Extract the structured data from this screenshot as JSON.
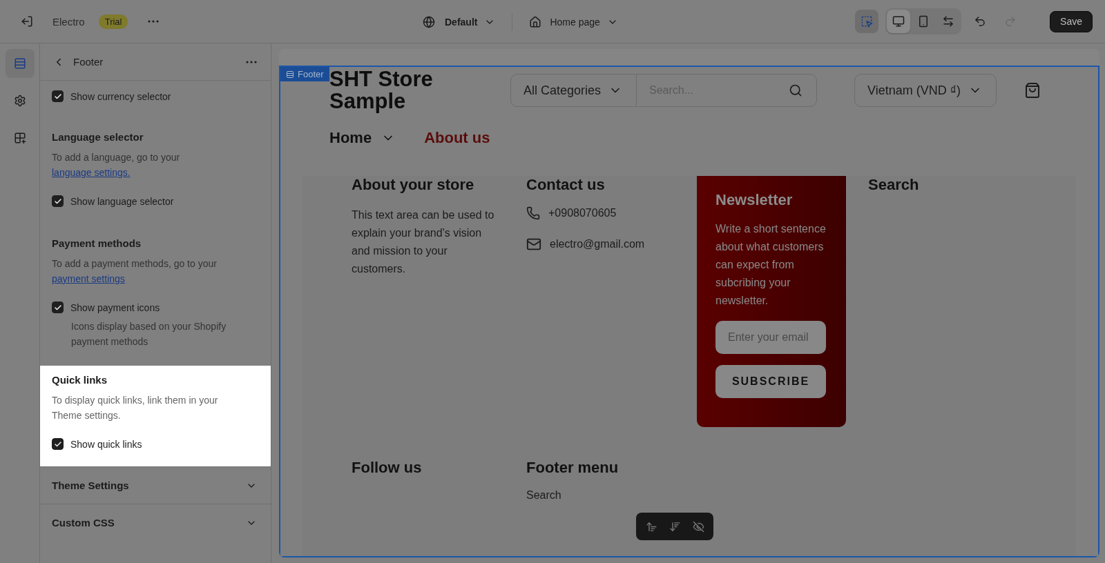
{
  "top_bar": {
    "store_name": "Electro",
    "plan_badge": "Trial",
    "theme": "Default",
    "page": "Home page",
    "inspect_selected": true,
    "devices": [
      {
        "kind": "desktop",
        "selected": true
      },
      {
        "kind": "mobile",
        "selected": false
      },
      {
        "kind": "fullwidth",
        "selected": false
      }
    ],
    "redo_disabled": true,
    "save": "Save"
  },
  "rail": [
    {
      "kind": "sections",
      "selected": true
    },
    {
      "kind": "settings",
      "selected": false
    },
    {
      "kind": "apps",
      "selected": false
    }
  ],
  "settings_panel": {
    "title": "Footer",
    "sections": [
      {
        "highlighted": false,
        "checkbox": {
          "label": "Show currency selector",
          "checked": true
        }
      },
      {
        "highlighted": false,
        "heading": "Language selector",
        "description": "To add a language, go to your",
        "link": "language settings.",
        "checkbox": {
          "label": "Show language selector",
          "checked": true
        }
      },
      {
        "highlighted": false,
        "heading": "Payment methods",
        "description": "To add a payment methods, go to your",
        "link": "payment settings",
        "checkbox": {
          "label": "Show payment icons",
          "checked": true,
          "hint": "Icons display based on your Shopify payment methods"
        }
      },
      {
        "highlighted": true,
        "heading": "Quick links",
        "description": "To display quick links, link them in your Theme settings.",
        "checkbox": {
          "label": "Show quick links",
          "checked": true
        }
      }
    ],
    "accordions": [
      {
        "title": "Theme Settings",
        "expanded": false
      },
      {
        "title": "Custom CSS",
        "expanded": false
      }
    ]
  },
  "preview": {
    "section_tag": "Footer",
    "store_header": {
      "logo": "SHT Store Sample",
      "category": "All Categories",
      "search_placeholder": "Search...",
      "currency": "Vietnam (VND ₫)",
      "nav": [
        {
          "label": "Home",
          "has_menu": true,
          "selected": false
        },
        {
          "label": "About us",
          "has_menu": false,
          "selected": true
        }
      ]
    },
    "footer_columns": [
      {
        "kind": "text",
        "heading": "About your store",
        "text": "This text area can be used to explain your brand's vision and mission to your customers."
      },
      {
        "kind": "contact",
        "heading": "Contact us",
        "phone": "+0908070605",
        "email": "electro@gmail.com"
      },
      {
        "kind": "newsletter",
        "heading": "Newsletter",
        "text": "Write a short sentence about what customers can expect from subcribing your newsletter.",
        "placeholder": "Enter your email",
        "button": "SUBSCRIBE"
      },
      {
        "kind": "text",
        "heading": "Search"
      },
      {
        "kind": "text",
        "heading": "Follow us"
      },
      {
        "kind": "links",
        "heading": "Footer menu",
        "links": [
          "Search"
        ]
      }
    ]
  }
}
